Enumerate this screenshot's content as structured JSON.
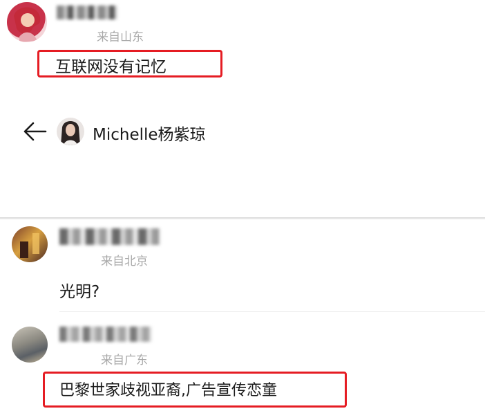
{
  "comments": [
    {
      "location": "来自山东",
      "text": "互联网没有记忆"
    },
    {
      "location": "来自北京",
      "text": "光明?"
    },
    {
      "location": "来自广东",
      "text": "巴黎世家歧视亚裔,广告宣传恋童"
    }
  ],
  "profile_header": {
    "name": "Michelle杨紫琼",
    "back_icon": "back-arrow-icon"
  },
  "colors": {
    "highlight": "#e51c23",
    "location": "#a9a9a9",
    "divider": "#e6e6e6"
  }
}
